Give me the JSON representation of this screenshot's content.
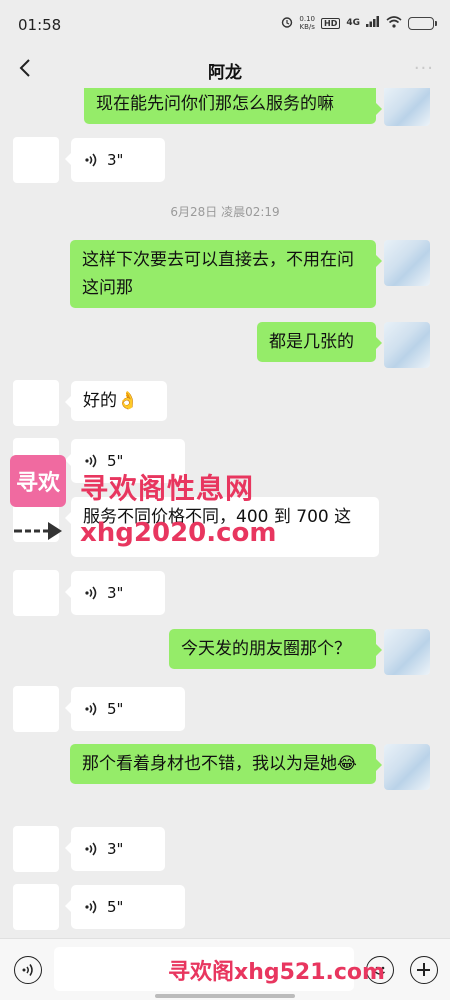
{
  "status": {
    "time": "01:58",
    "net_speed": "0.10",
    "net_unit": "KB/s",
    "hd": "HD",
    "network": "4G"
  },
  "header": {
    "title": "阿龙",
    "more": "···"
  },
  "messages": {
    "m1": "现在能先问你们那怎么服务的嘛",
    "v1": "3\"",
    "timestamp": "6月28日 凌晨02:19",
    "m2": "这样下次要去可以直接去，不用在问这问那",
    "m3": "都是几张的",
    "m4": "好的👌",
    "v2": "5\"",
    "m5": "服务不同价格不同，400 到 700 这",
    "v3": "3\"",
    "m6": "今天发的朋友圈那个？",
    "v4": "5\"",
    "m7": "那个看着身材也不错，我以为是她😂",
    "v5": "3\"",
    "v6": "5\""
  },
  "watermark": {
    "logo": "寻欢",
    "title": "寻欢阁性息网",
    "url": "xhg2020.com",
    "bottom": "寻欢阁xhg521.com"
  },
  "icons": [
    "back-icon",
    "voice-wave-icon",
    "emoji-icon",
    "plus-icon",
    "wifi-icon",
    "battery-icon"
  ]
}
